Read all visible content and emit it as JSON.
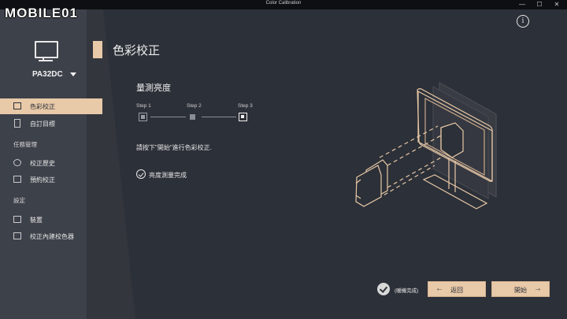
{
  "window": {
    "title": "Color Calibration",
    "minimize": "—",
    "maximize": "☐",
    "close": "✕"
  },
  "watermark": {
    "text": "MOBILE01"
  },
  "sidebar": {
    "model": "PA32DC",
    "items": [
      {
        "label": "色彩校正",
        "icon": "screen-icon",
        "active": true
      },
      {
        "label": "自訂目標",
        "icon": "document-icon",
        "active": false
      }
    ],
    "sections": [
      {
        "title": "任務管理",
        "items": [
          {
            "label": "校正歷史",
            "icon": "history-icon"
          },
          {
            "label": "預約校正",
            "icon": "calendar-icon"
          }
        ]
      },
      {
        "title": "設定",
        "items": [
          {
            "label": "裝置",
            "icon": "monitor-icon"
          },
          {
            "label": "校正內建校色器",
            "icon": "monitor-sensor-icon"
          }
        ]
      }
    ]
  },
  "header": {
    "title": "色彩校正",
    "info_icon": "i"
  },
  "main": {
    "subtitle": "量測亮度",
    "steps": [
      {
        "label": "Step 1",
        "state": "done"
      },
      {
        "label": "Step 2",
        "state": "pending"
      },
      {
        "label": "Step 3",
        "state": "current"
      }
    ],
    "instruction": "請按下\"開始\"進行色彩校正.",
    "status": "亮度測量完成"
  },
  "footer": {
    "skip_label": "(暖機完成)",
    "back_label": "返回",
    "back_arrow": "←",
    "start_label": "開始",
    "start_arrow": "→"
  },
  "colors": {
    "accent": "#e8c9a8",
    "background": "#2c3038",
    "sidebar": "#3d414a"
  }
}
